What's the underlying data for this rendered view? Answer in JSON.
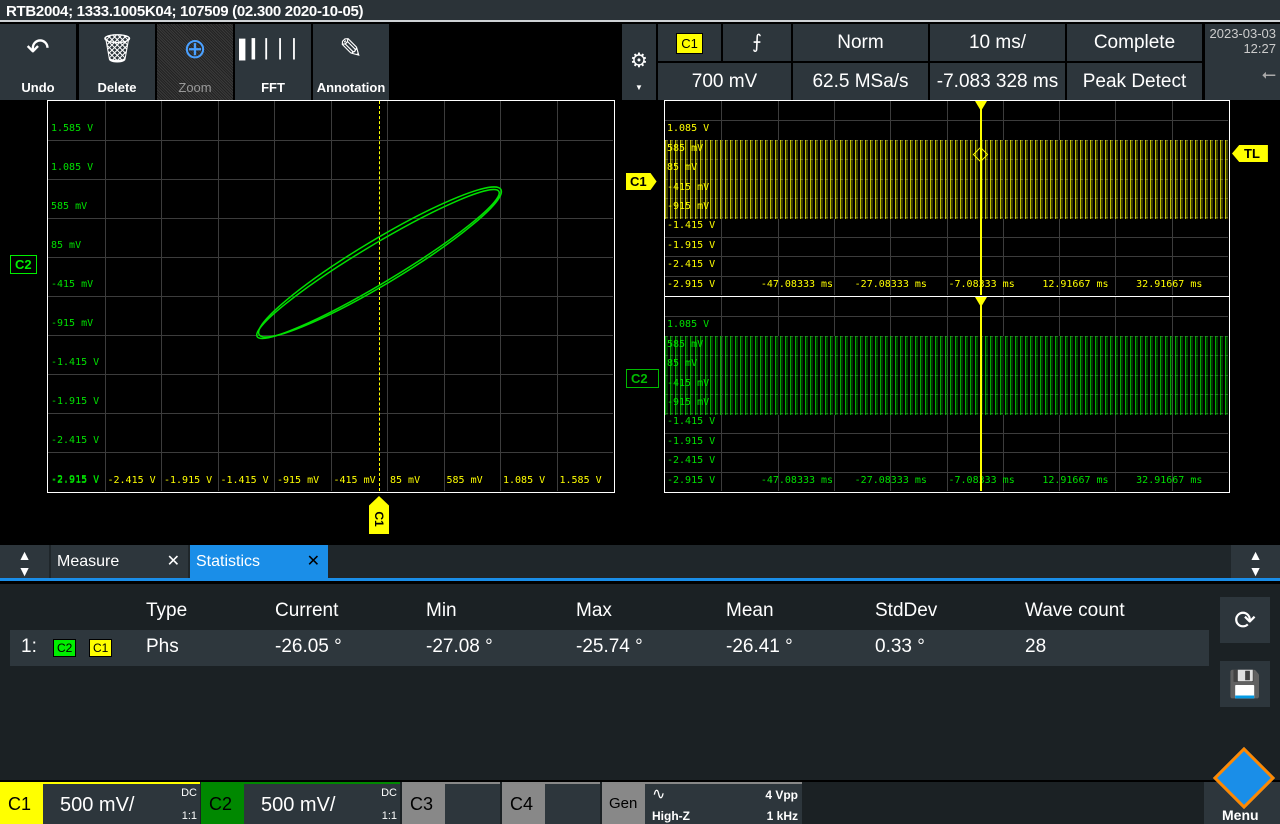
{
  "title": "RTB2004; 1333.1005K04; 107509 (02.300 2020-10-05)",
  "toolbar": {
    "undo": "Undo",
    "delete": "Delete",
    "zoom": "Zoom",
    "fft": "FFT",
    "annotation": "Annotation"
  },
  "info": {
    "trigger_source": "C1",
    "trigger_slope": "⨍",
    "trigger_mode": "Norm",
    "timebase": "10 ms/",
    "acq_state": "Complete",
    "trigger_level": "700 mV",
    "sample_rate": "62.5 MSa/s",
    "position": "-7.083 328 ms",
    "acq_mode": "Peak Detect"
  },
  "datetime": {
    "date": "2023-03-03",
    "time": "12:27"
  },
  "xy": {
    "channel_y": "C2",
    "channel_x": "C1",
    "y_labels": [
      "1.585 V",
      "1.085 V",
      "585 mV",
      "85 mV",
      "-415 mV",
      "-915 mV",
      "-1.415 V",
      "-1.915 V",
      "-2.415 V",
      "-2.915 V"
    ],
    "x_labels": [
      "-2.415 V",
      "-1.915 V",
      "-1.415 V",
      "-915 mV",
      "-415 mV",
      "85 mV",
      "585 mV",
      "1.085 V",
      "1.585 V"
    ]
  },
  "yt": {
    "y_labels": [
      "1.085 V",
      "585 mV",
      "85 mV",
      "-415 mV",
      "-915 mV",
      "-1.415 V",
      "-1.915 V",
      "-2.415 V",
      "-2.915 V"
    ],
    "t_labels": [
      "-47.08333 ms",
      "-27.08333 ms",
      "-7.08333 ms",
      "12.91667 ms",
      "32.91667 ms"
    ],
    "ch1": "C1",
    "ch2": "C2",
    "trigger_label": "TL"
  },
  "colors": {
    "c1": "#ffff00",
    "c2": "#00e000",
    "accent": "#1a8ee8"
  },
  "tabs": [
    {
      "label": "Measure"
    },
    {
      "label": "Statistics",
      "active": true
    }
  ],
  "stats": {
    "headers": [
      "Type",
      "Current",
      "Min",
      "Max",
      "Mean",
      "StdDev",
      "Wave count"
    ],
    "rows": [
      {
        "index": "1:",
        "src1": "C2",
        "src2": "C1",
        "type": "Phs",
        "current": "-26.05 °",
        "min": "-27.08 °",
        "max": "-25.74 °",
        "mean": "-26.41 °",
        "stddev": "0.33 °",
        "count": "28"
      }
    ]
  },
  "bottom": {
    "c1": {
      "label": "C1",
      "scale": "500 mV/",
      "coupling": "DC",
      "probe": "1:1"
    },
    "c2": {
      "label": "C2",
      "scale": "500 mV/",
      "coupling": "DC",
      "probe": "1:1"
    },
    "c3": "C3",
    "c4": "C4",
    "gen": {
      "label": "Gen",
      "impedance": "High-Z",
      "amplitude": "4 Vpp",
      "freq": "1 kHz"
    },
    "menu": "Menu"
  }
}
